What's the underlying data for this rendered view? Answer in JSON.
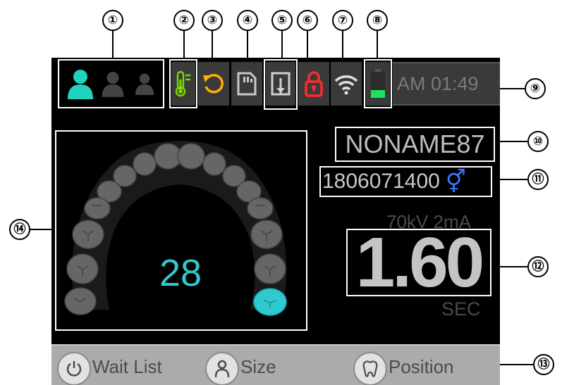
{
  "callouts": [
    "①",
    "②",
    "③",
    "④",
    "⑤",
    "⑥",
    "⑦",
    "⑧",
    "⑨",
    "⑩",
    "⑪",
    "⑫",
    "⑬",
    "⑭"
  ],
  "status_bar": {
    "patient_types": [
      "adult-icon",
      "teen-icon",
      "child-icon"
    ],
    "selected_patient_type": "adult-icon",
    "icons": [
      "thermometer-icon",
      "reset-icon",
      "sd-card-icon",
      "save-icon",
      "lock-icon",
      "wifi-icon",
      "battery-icon"
    ],
    "time": "AM 01:49",
    "colors": {
      "selected": "#1fd3bd",
      "temperature": "#7cd800",
      "reset": "#ffb000",
      "lock": "#ff2a2a",
      "battery": "#1ee05f"
    }
  },
  "patient": {
    "name": "NONAME87",
    "id": "1806071400",
    "gender_symbol": "⚥",
    "gender_color": "#3a76ff"
  },
  "exposure": {
    "settings": "70kV 2mA",
    "time": "1.60",
    "unit": "SEC"
  },
  "tooth": {
    "selected_number": "28",
    "selected_color": "#2ecad0"
  },
  "toolbar": {
    "wait_list": "Wait List",
    "size": "Size",
    "position": "Position"
  }
}
